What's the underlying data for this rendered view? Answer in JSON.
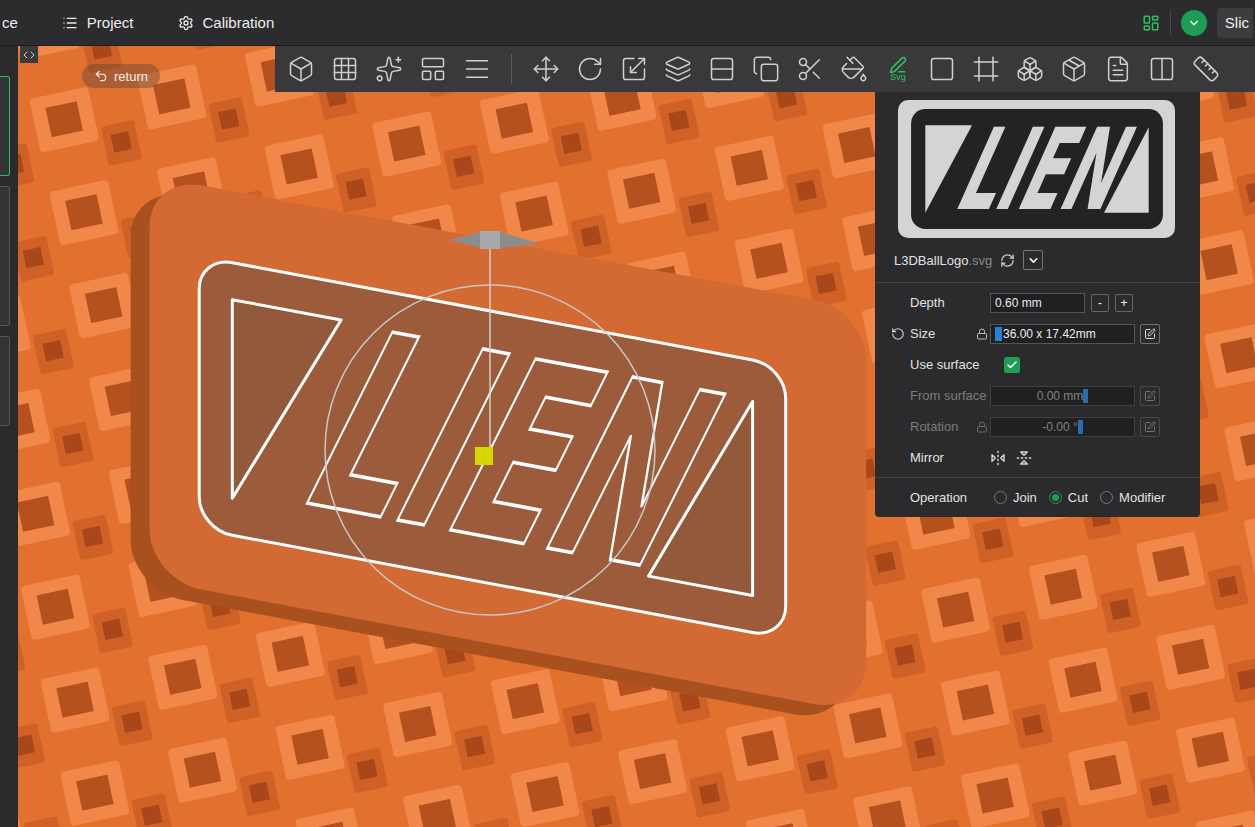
{
  "top_bar": {
    "menu": [
      {
        "label": "ce",
        "icon": "none"
      },
      {
        "label": "Project",
        "icon": "list"
      },
      {
        "label": "Calibration",
        "icon": "gear"
      }
    ],
    "slice_button": "Slic"
  },
  "return_button": "return",
  "toolbar": {
    "svg_label": "Svg"
  },
  "viewport": {
    "object_logo_text": "LIEN"
  },
  "emboss_panel": {
    "preview_logo_text": "LIEN",
    "file_name": "L3DBallLogo",
    "file_ext": ".svg",
    "fields": [
      {
        "kind": "stepper",
        "label": "Depth",
        "value": "0.60 mm",
        "disabled": false,
        "minus": "-",
        "plus": "+"
      },
      {
        "kind": "size",
        "label": "Size",
        "value": "36.00 x 17.42mm",
        "disabled": false,
        "locked": true
      },
      {
        "kind": "checkbox",
        "label": "Use surface",
        "checked": true,
        "disabled": false
      },
      {
        "kind": "edit",
        "label": "From surface",
        "value": "0.00 mm",
        "disabled": true
      },
      {
        "kind": "edit",
        "label": "Rotation",
        "value": "-0.00 °",
        "disabled": true,
        "locked": true
      }
    ],
    "mirror": {
      "label": "Mirror"
    },
    "operation": {
      "label": "Operation",
      "options": [
        {
          "label": "Join",
          "selected": false
        },
        {
          "label": "Cut",
          "selected": true
        },
        {
          "label": "Modifier",
          "selected": false
        }
      ]
    }
  }
}
